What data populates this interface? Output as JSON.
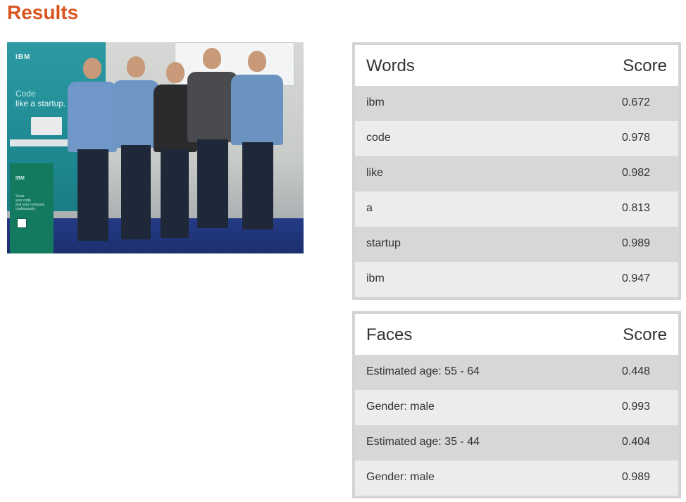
{
  "page": {
    "title": "Results"
  },
  "photo": {
    "description_icon": "group-photo-image",
    "booth_brand": "IBM",
    "booth_slogan_line1": "Code",
    "booth_slogan_line2": "like a startup.",
    "stand_brand": "IBM",
    "stand_text_line1": "Scale",
    "stand_text_line2": "your code",
    "stand_text_line3": "and your company",
    "stand_text_line4": "continuously."
  },
  "words_table": {
    "header": {
      "label": "Words",
      "score": "Score"
    },
    "rows": [
      {
        "label": "ibm",
        "score": "0.672"
      },
      {
        "label": "code",
        "score": "0.978"
      },
      {
        "label": "like",
        "score": "0.982"
      },
      {
        "label": "a",
        "score": "0.813"
      },
      {
        "label": "startup",
        "score": "0.989"
      },
      {
        "label": "ibm",
        "score": "0.947"
      }
    ]
  },
  "faces_table": {
    "header": {
      "label": "Faces",
      "score": "Score"
    },
    "rows": [
      {
        "label": "Estimated age: 55 - 64",
        "score": "0.448"
      },
      {
        "label": "Gender: male",
        "score": "0.993"
      },
      {
        "label": "Estimated age: 35 - 44",
        "score": "0.404"
      },
      {
        "label": "Gender: male",
        "score": "0.989"
      }
    ]
  },
  "colors": {
    "accent": "#d9541e",
    "row_dark": "#d7d7d7",
    "row_light": "#ececec"
  }
}
